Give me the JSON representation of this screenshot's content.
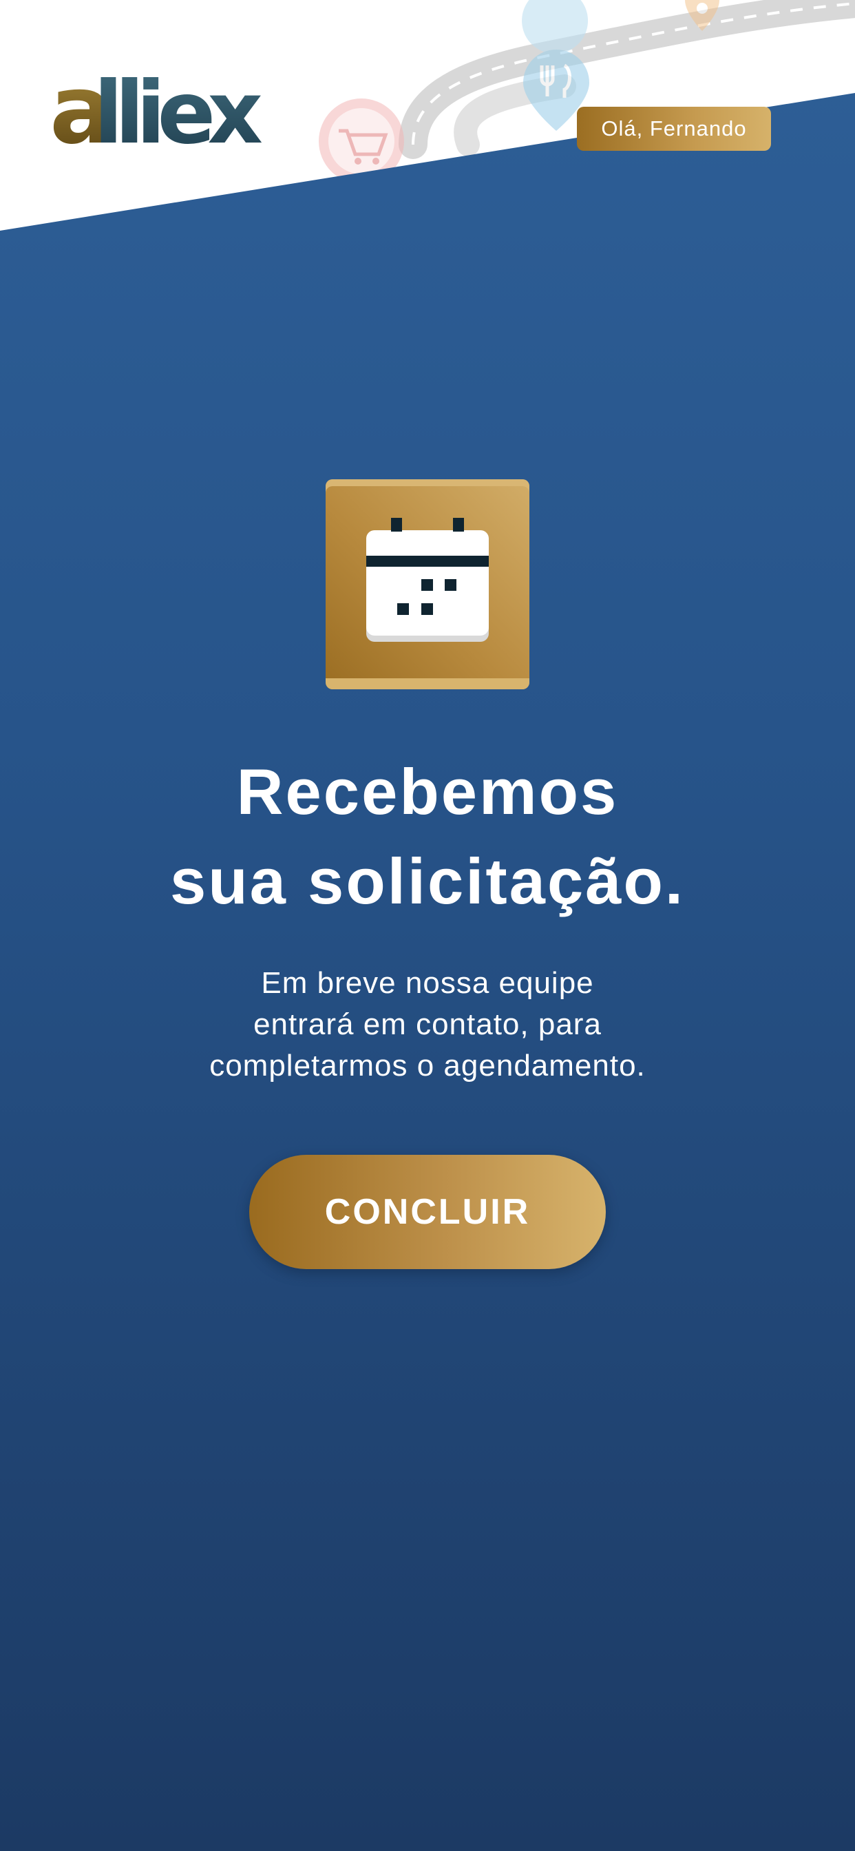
{
  "header": {
    "logo_text": "alliex",
    "greeting": "Olá, Fernando"
  },
  "main": {
    "icon": "calendar-icon",
    "title_line1": "Recebemos",
    "title_line2": "sua solicitação.",
    "message_line1": "Em breve nossa equipe",
    "message_line2": "entrará em contato, para",
    "message_line3": "completarmos o agendamento.",
    "button_label": "CONCLUIR"
  },
  "colors": {
    "primary_blue": "#27548a",
    "dark_blue": "#1c3a64",
    "gold": "#b88a3e",
    "gold_light": "#d6b26a"
  }
}
